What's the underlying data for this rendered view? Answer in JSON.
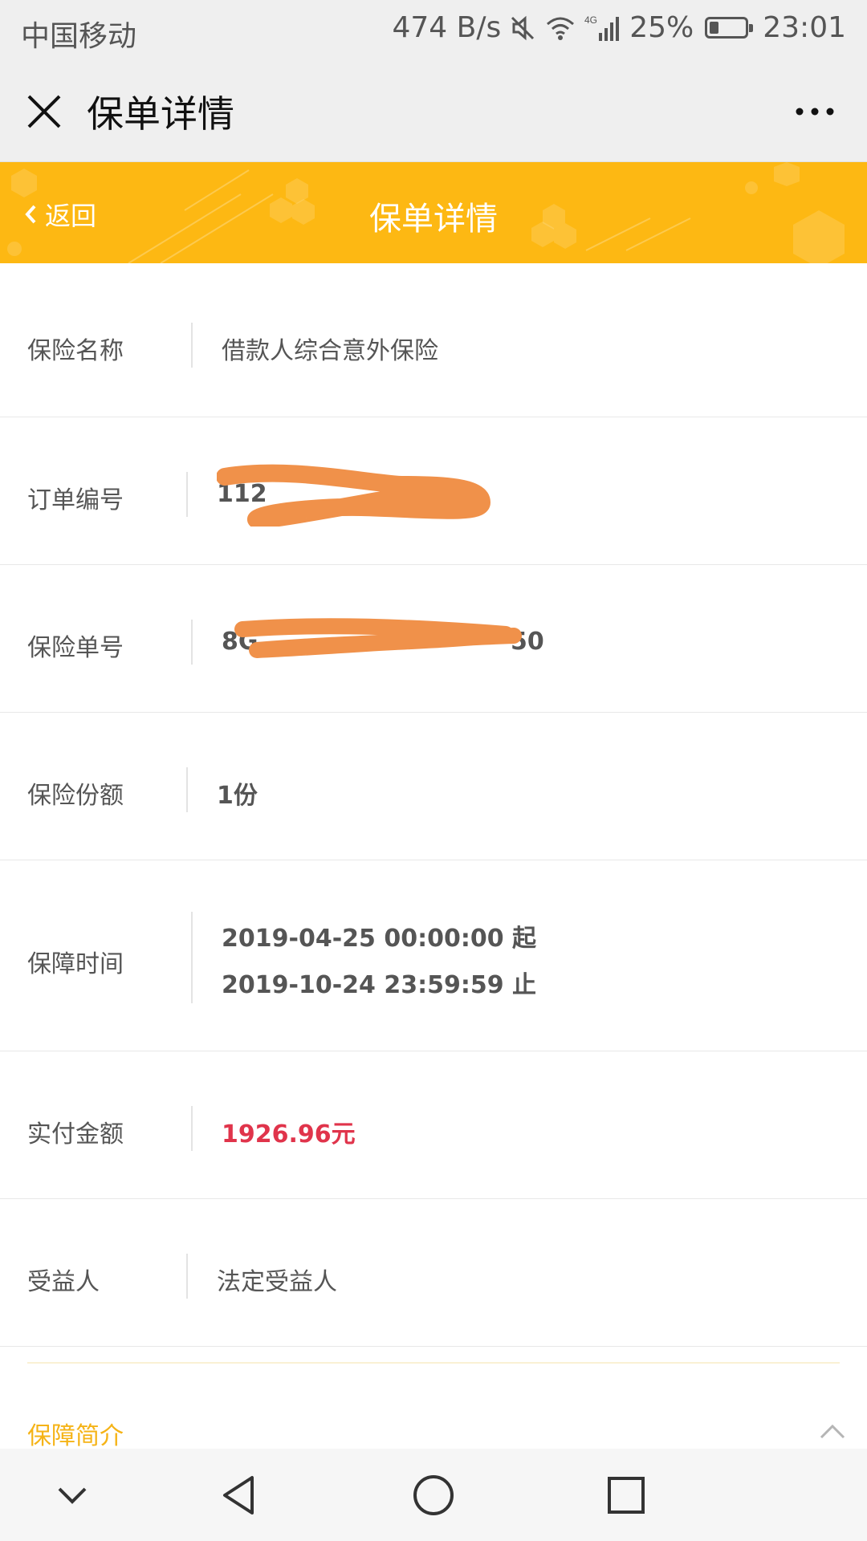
{
  "status_bar": {
    "carrier": "中国移动",
    "net_speed": "474 B/s",
    "network": "4G",
    "battery_text": "25%",
    "battery_level": 0.25,
    "time": "23:01"
  },
  "app_header": {
    "title": "保单详情",
    "close_icon": "close-icon",
    "more_icon": "more-icon"
  },
  "banner": {
    "back_label": "返回",
    "title": "保单详情",
    "color": "#fdb813"
  },
  "details": {
    "insurance_name_label": "保险名称",
    "insurance_name_value": "借款人综合意外保险",
    "order_no_label": "订单编号",
    "order_no_value": "112",
    "policy_no_label": "保险单号",
    "policy_no_value": "8G",
    "policy_no_suffix": "50",
    "shares_label": "保险份额",
    "shares_value": "1份",
    "coverage_label": "保障时间",
    "coverage_start": "2019-04-25 00:00:00 起",
    "coverage_end": "2019-10-24 23:59:59 止",
    "paid_label": "实付金额",
    "paid_value": "1926.96元",
    "beneficiary_label": "受益人",
    "beneficiary_value": "法定受益人"
  },
  "section": {
    "title": "保障简介"
  },
  "colors": {
    "accent_yellow": "#fdb813",
    "amount_red": "#e0344b",
    "redaction_orange": "#f0914a"
  },
  "nav_bar": {
    "icons": [
      "chevron-down-icon",
      "back-triangle-icon",
      "home-circle-icon",
      "recents-square-icon"
    ]
  }
}
